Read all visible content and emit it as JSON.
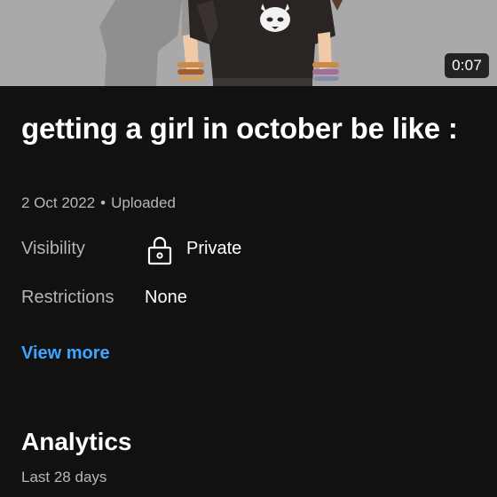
{
  "video": {
    "duration": "0:07",
    "title": "getting a girl in october be like :",
    "date": "2 Oct 2022",
    "separator": "•",
    "status": "Uploaded"
  },
  "details": {
    "visibility_label": "Visibility",
    "visibility_value": "Private",
    "visibility_icon": "lock-icon",
    "restrictions_label": "Restrictions",
    "restrictions_value": "None"
  },
  "view_more_label": "View more",
  "analytics": {
    "title": "Analytics",
    "period": "Last 28 days"
  },
  "colors": {
    "background": "#111111",
    "link": "#3ea6ff",
    "secondary_text": "#b8b8b8"
  }
}
